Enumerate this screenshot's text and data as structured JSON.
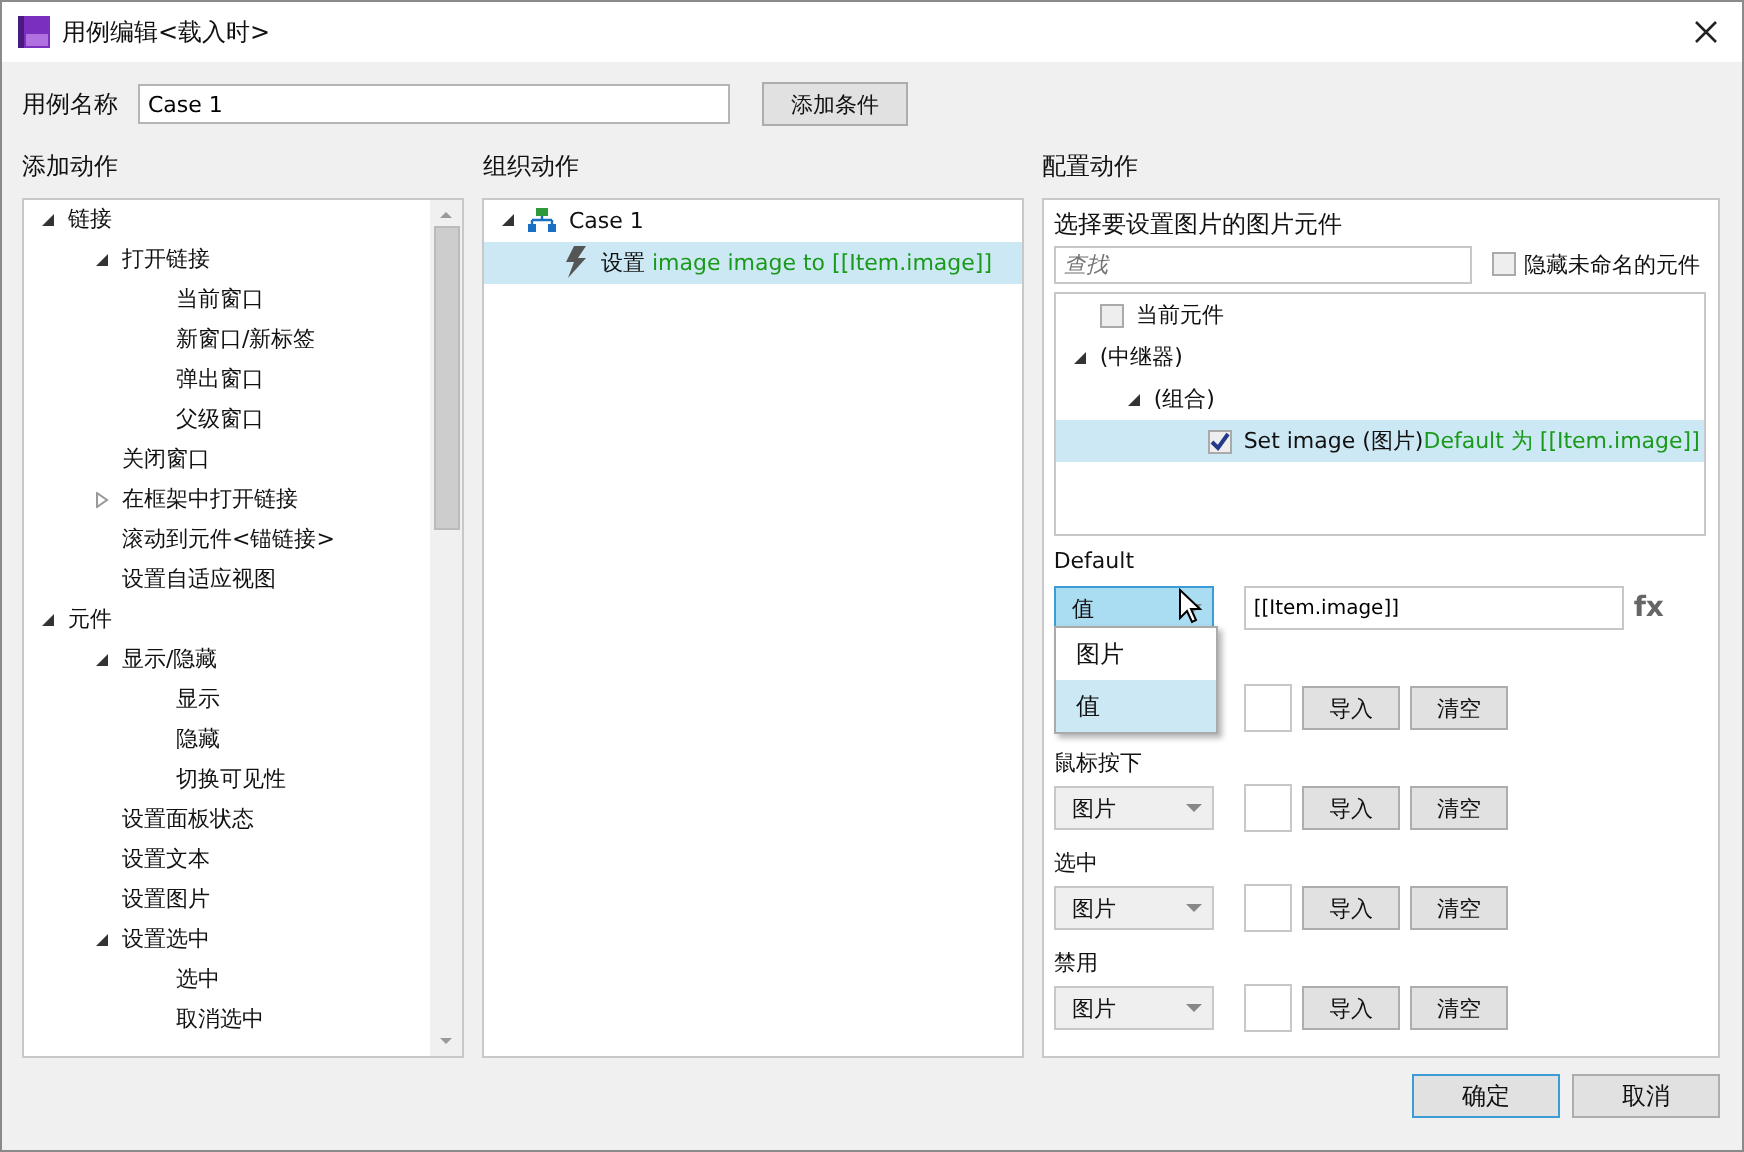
{
  "window": {
    "title": "用例编辑<载入时>"
  },
  "case_name": {
    "label": "用例名称",
    "value": "Case 1"
  },
  "add_condition_button": "添加条件",
  "add_actions": {
    "title": "添加动作",
    "tree": [
      {
        "label": "链接",
        "kind": "folder",
        "expanded": true,
        "children": [
          {
            "label": "打开链接",
            "kind": "folder",
            "expanded": true,
            "children": [
              {
                "label": "当前窗口",
                "kind": "action"
              },
              {
                "label": "新窗口/新标签",
                "kind": "action"
              },
              {
                "label": "弹出窗口",
                "kind": "action"
              },
              {
                "label": "父级窗口",
                "kind": "action"
              }
            ]
          },
          {
            "label": "关闭窗口",
            "kind": "action"
          },
          {
            "label": "在框架中打开链接",
            "kind": "folder",
            "expanded": false
          },
          {
            "label": "滚动到元件<锚链接>",
            "kind": "action"
          },
          {
            "label": "设置自适应视图",
            "kind": "action"
          }
        ]
      },
      {
        "label": "元件",
        "kind": "folder",
        "expanded": true,
        "children": [
          {
            "label": "显示/隐藏",
            "kind": "folder",
            "expanded": true,
            "children": [
              {
                "label": "显示",
                "kind": "action"
              },
              {
                "label": "隐藏",
                "kind": "action"
              },
              {
                "label": "切换可见性",
                "kind": "action"
              }
            ]
          },
          {
            "label": "设置面板状态",
            "kind": "action"
          },
          {
            "label": "设置文本",
            "kind": "action"
          },
          {
            "label": "设置图片",
            "kind": "action"
          },
          {
            "label": "设置选中",
            "kind": "folder",
            "expanded": true,
            "children": [
              {
                "label": "选中",
                "kind": "action"
              },
              {
                "label": "取消选中",
                "kind": "action"
              }
            ]
          }
        ]
      }
    ]
  },
  "organize_actions": {
    "title": "组织动作",
    "case": {
      "label": "Case 1",
      "expanded": true
    },
    "actions": [
      {
        "verb": "设置",
        "detail": "image image to [[Item.image]]",
        "selected": true
      }
    ]
  },
  "configure": {
    "title": "配置动作",
    "subtitle": "选择要设置图片的图片元件",
    "search": {
      "placeholder": "查找"
    },
    "hide_unnamed": {
      "label": "隐藏未命名的元件",
      "checked": false
    },
    "widgets": [
      {
        "label": "当前元件",
        "kind": "check",
        "checked": false,
        "selected": false
      },
      {
        "label": "(中继器)",
        "kind": "folder",
        "expanded": true,
        "children": [
          {
            "label": "(组合)",
            "kind": "folder",
            "expanded": true,
            "children": [
              {
                "label": "Set image (图片)",
                "detail": "Default 为 [[Item.image]]",
                "kind": "check",
                "checked": true,
                "selected": true
              }
            ]
          }
        ]
      }
    ],
    "states": [
      {
        "label": "Default",
        "kind": "value",
        "dropdown": "值",
        "value": "[[Item.image]]",
        "fx": "fx",
        "open": true
      },
      {
        "kind": "image",
        "import": "导入",
        "clear": "清空"
      },
      {
        "label": "鼠标按下",
        "kind": "image",
        "dropdown": "图片",
        "import": "导入",
        "clear": "清空"
      },
      {
        "label": "选中",
        "kind": "image",
        "dropdown": "图片",
        "import": "导入",
        "clear": "清空"
      },
      {
        "label": "禁用",
        "kind": "image",
        "dropdown": "图片",
        "import": "导入",
        "clear": "清空"
      }
    ],
    "menu": [
      {
        "label": "图片",
        "selected": false
      },
      {
        "label": "值",
        "selected": true
      }
    ]
  },
  "buttons": [
    {
      "label": "确定",
      "default": true
    },
    {
      "label": "取消",
      "default": false
    }
  ]
}
